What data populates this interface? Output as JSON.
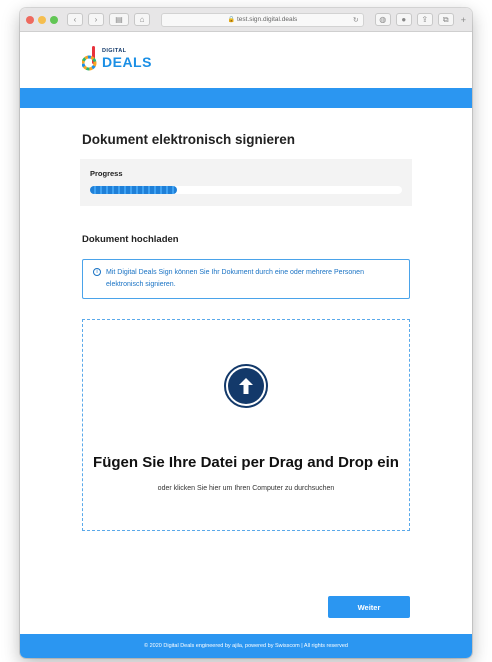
{
  "browser": {
    "url": "test.sign.digital.deals",
    "lock_glyph": "🔒",
    "reload_glyph": "↻",
    "back_glyph": "‹",
    "forward_glyph": "›",
    "sidebar_glyph": "▤",
    "home_glyph": "⌂",
    "shield_glyph": "◍",
    "extension_glyph": "●",
    "share_glyph": "⇪",
    "tabs_glyph": "⧉",
    "new_tab_glyph": "+"
  },
  "header": {
    "logo_small": "DIGITAL",
    "logo_large": "DEALS"
  },
  "page": {
    "title": "Dokument elektronisch signieren",
    "progress_label": "Progress",
    "progress_fraction": 0.28,
    "section_title": "Dokument hochladen",
    "info_icon": "i",
    "info_text": "Mit Digital Deals Sign können Sie Ihr Dokument durch eine oder mehrere Personen elektronisch signieren.",
    "drop_title": "Fügen Sie Ihre Datei per Drag and Drop ein",
    "drop_subtitle": "oder klicken Sie hier um Ihren Computer zu durchsuchen",
    "next_button": "Weiter"
  },
  "footer": {
    "text": "© 2020 Digital Deals engineered by ajila, powered by Swisscom | All rights reserved"
  },
  "colors": {
    "brand_blue": "#2b96f1",
    "navy": "#13396a",
    "info_blue": "#1a73c4"
  }
}
